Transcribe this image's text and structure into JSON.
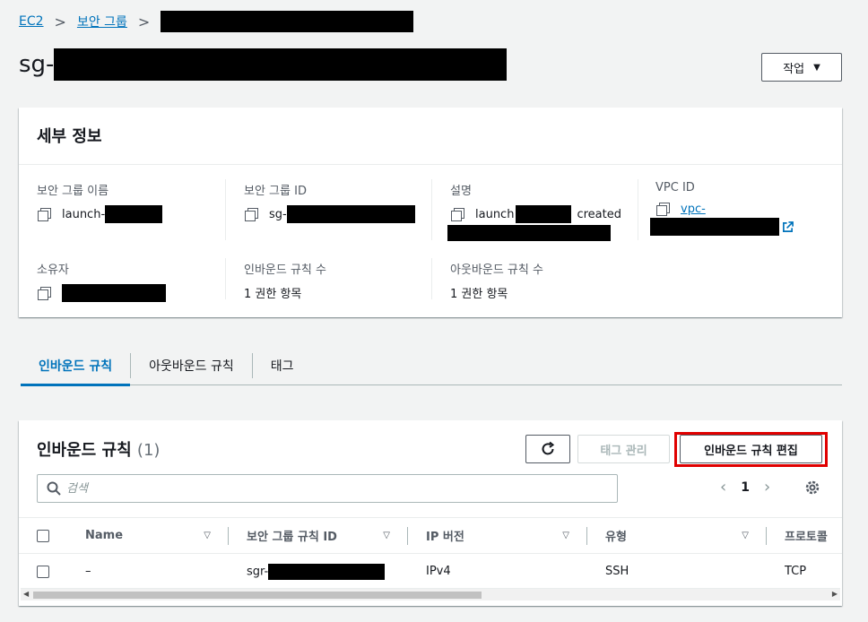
{
  "breadcrumb": {
    "root": "EC2",
    "section": "보안 그룹"
  },
  "title": {
    "prefix": "sg-"
  },
  "actions_label": "작업",
  "details": {
    "heading": "세부 정보",
    "sg_name": {
      "label": "보안 그룹 이름",
      "prefix": "launch-"
    },
    "sg_id": {
      "label": "보안 그룹 ID",
      "prefix": "sg-"
    },
    "description": {
      "label": "설명",
      "prefix": "launch",
      "suffix": "created"
    },
    "vpc": {
      "label": "VPC ID",
      "prefix": "vpc-"
    },
    "owner": {
      "label": "소유자"
    },
    "inbound_count": {
      "label": "인바운드 규칙 수",
      "value": "1 권한 항목"
    },
    "outbound_count": {
      "label": "아웃바운드 규칙 수",
      "value": "1 권한 항목"
    }
  },
  "tabs": [
    {
      "label": "인바운드 규칙",
      "active": true
    },
    {
      "label": "아웃바운드 규칙",
      "active": false
    },
    {
      "label": "태그",
      "active": false
    }
  ],
  "rules": {
    "title": "인바운드 규칙",
    "count": "(1)",
    "manage_tags": "태그 관리",
    "edit_rules": "인바운드 규칙 편집",
    "search_placeholder": "검색",
    "page": "1",
    "columns": [
      "Name",
      "보안 그룹 규칙 ID",
      "IP 버전",
      "유형",
      "프로토콜"
    ],
    "rows": [
      {
        "name": "–",
        "rule_id_prefix": "sgr-",
        "ip_version": "IPv4",
        "type": "SSH",
        "protocol": "TCP"
      }
    ]
  }
}
